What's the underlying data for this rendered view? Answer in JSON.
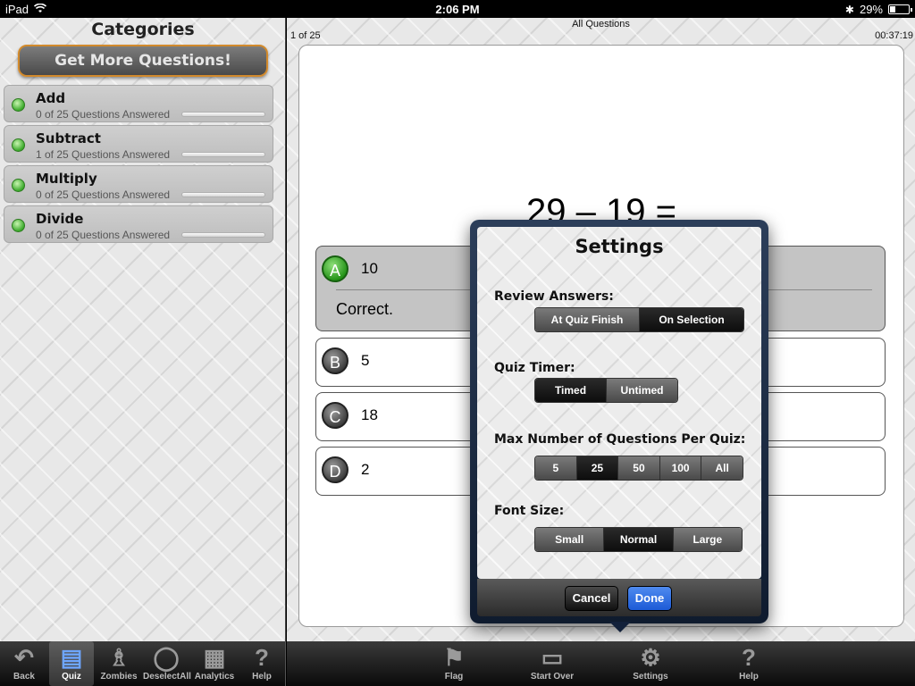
{
  "status": {
    "device": "iPad",
    "time": "2:06 PM",
    "battery": "29%",
    "battery_level": 0.29
  },
  "left": {
    "title": "Categories",
    "more_button": "Get More Questions!",
    "categories": [
      {
        "name": "Add",
        "sub": "0 of 25 Questions Answered",
        "progress": 0
      },
      {
        "name": "Subtract",
        "sub": "1 of 25 Questions Answered",
        "progress": 0.04
      },
      {
        "name": "Multiply",
        "sub": "0 of 25 Questions Answered",
        "progress": 0
      },
      {
        "name": "Divide",
        "sub": "0 of 25 Questions Answered",
        "progress": 0
      }
    ]
  },
  "quiz": {
    "nav_title": "All Questions",
    "counter": "1 of 25",
    "timer": "00:37:19",
    "question": "29 – 19 =",
    "answers": [
      {
        "letter": "A",
        "text": "10",
        "feedback": "Correct."
      },
      {
        "letter": "B",
        "text": "5"
      },
      {
        "letter": "C",
        "text": "18"
      },
      {
        "letter": "D",
        "text": "2"
      }
    ]
  },
  "settings": {
    "title": "Settings",
    "review_label": "Review Answers:",
    "review_options": [
      "At Quiz Finish",
      "On Selection"
    ],
    "review_selected": "On Selection",
    "timer_label": "Quiz Timer:",
    "timer_options": [
      "Timed",
      "Untimed"
    ],
    "timer_selected": "Timed",
    "max_label": "Max Number of Questions Per Quiz:",
    "max_options": [
      "5",
      "25",
      "50",
      "100",
      "All"
    ],
    "max_selected": "25",
    "font_label": "Font Size:",
    "font_options": [
      "Small",
      "Normal",
      "Large"
    ],
    "font_selected": "Normal",
    "cancel": "Cancel",
    "done": "Done"
  },
  "toolbar_left": [
    {
      "label": "Back",
      "icon": "back-arrow-icon"
    },
    {
      "label": "Quiz",
      "icon": "quiz-icon",
      "active": true
    },
    {
      "label": "Zombies",
      "icon": "zombie-icon"
    },
    {
      "label": "DeselectAll",
      "icon": "circle-icon"
    },
    {
      "label": "Analytics",
      "icon": "grid-icon"
    },
    {
      "label": "Help",
      "icon": "question-icon"
    }
  ],
  "toolbar_right": [
    {
      "label": "Flag",
      "icon": "flag-icon"
    },
    {
      "label": "Start Over",
      "icon": "start-over-icon"
    },
    {
      "label": "Settings",
      "icon": "gear-icon"
    },
    {
      "label": "Help",
      "icon": "question-icon"
    }
  ]
}
